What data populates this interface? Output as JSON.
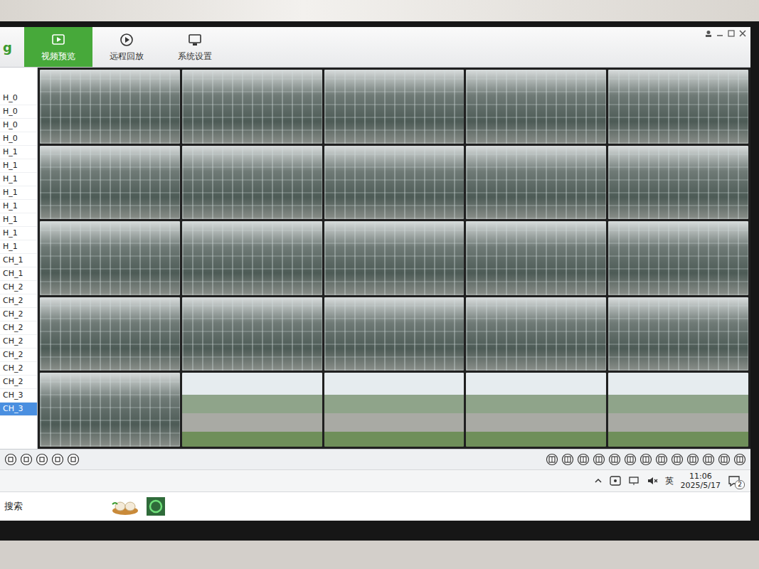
{
  "app": {
    "logo_fragment": "g"
  },
  "tabs": [
    {
      "label": "视频预览",
      "selected": true
    },
    {
      "label": "远程回放",
      "selected": false
    },
    {
      "label": "系统设置",
      "selected": false
    }
  ],
  "sidebar": {
    "items": [
      {
        "label": "H_0",
        "selected": false
      },
      {
        "label": "H_0",
        "selected": false
      },
      {
        "label": "H_0",
        "selected": false
      },
      {
        "label": "H_0",
        "selected": false
      },
      {
        "label": "H_1",
        "selected": false
      },
      {
        "label": "H_1",
        "selected": false
      },
      {
        "label": "H_1",
        "selected": false
      },
      {
        "label": "H_1",
        "selected": false
      },
      {
        "label": "H_1",
        "selected": false
      },
      {
        "label": "H_1",
        "selected": false
      },
      {
        "label": "H_1",
        "selected": false
      },
      {
        "label": "H_1",
        "selected": false
      },
      {
        "label": "CH_1",
        "selected": false
      },
      {
        "label": "CH_1",
        "selected": false
      },
      {
        "label": "CH_2",
        "selected": false
      },
      {
        "label": "CH_2",
        "selected": false
      },
      {
        "label": "CH_2",
        "selected": false
      },
      {
        "label": "CH_2",
        "selected": false
      },
      {
        "label": "CH_2",
        "selected": false
      },
      {
        "label": "CH_2",
        "selected": false
      },
      {
        "label": "CH_2",
        "selected": false
      },
      {
        "label": "CH_2",
        "selected": false
      },
      {
        "label": "CH_3",
        "selected": false
      },
      {
        "label": "CH_3",
        "selected": true
      }
    ]
  },
  "cameras": [
    {
      "kind": "barn"
    },
    {
      "kind": "barn"
    },
    {
      "kind": "barn"
    },
    {
      "kind": "barn"
    },
    {
      "kind": "barn"
    },
    {
      "kind": "barn"
    },
    {
      "kind": "barn"
    },
    {
      "kind": "barn"
    },
    {
      "kind": "barn"
    },
    {
      "kind": "barn"
    },
    {
      "kind": "barn"
    },
    {
      "kind": "barn"
    },
    {
      "kind": "barn"
    },
    {
      "kind": "barn"
    },
    {
      "kind": "barn"
    },
    {
      "kind": "barn"
    },
    {
      "kind": "barn"
    },
    {
      "kind": "barn"
    },
    {
      "kind": "barn"
    },
    {
      "kind": "barn"
    },
    {
      "kind": "barn"
    },
    {
      "kind": "outdoor"
    },
    {
      "kind": "outdoor"
    },
    {
      "kind": "outdoor"
    },
    {
      "kind": "outdoor"
    }
  ],
  "search": {
    "label": "搜索"
  },
  "taskbar": {
    "ime": "英",
    "time": "11:06",
    "date": "2025/5/17",
    "notifications": "2"
  }
}
